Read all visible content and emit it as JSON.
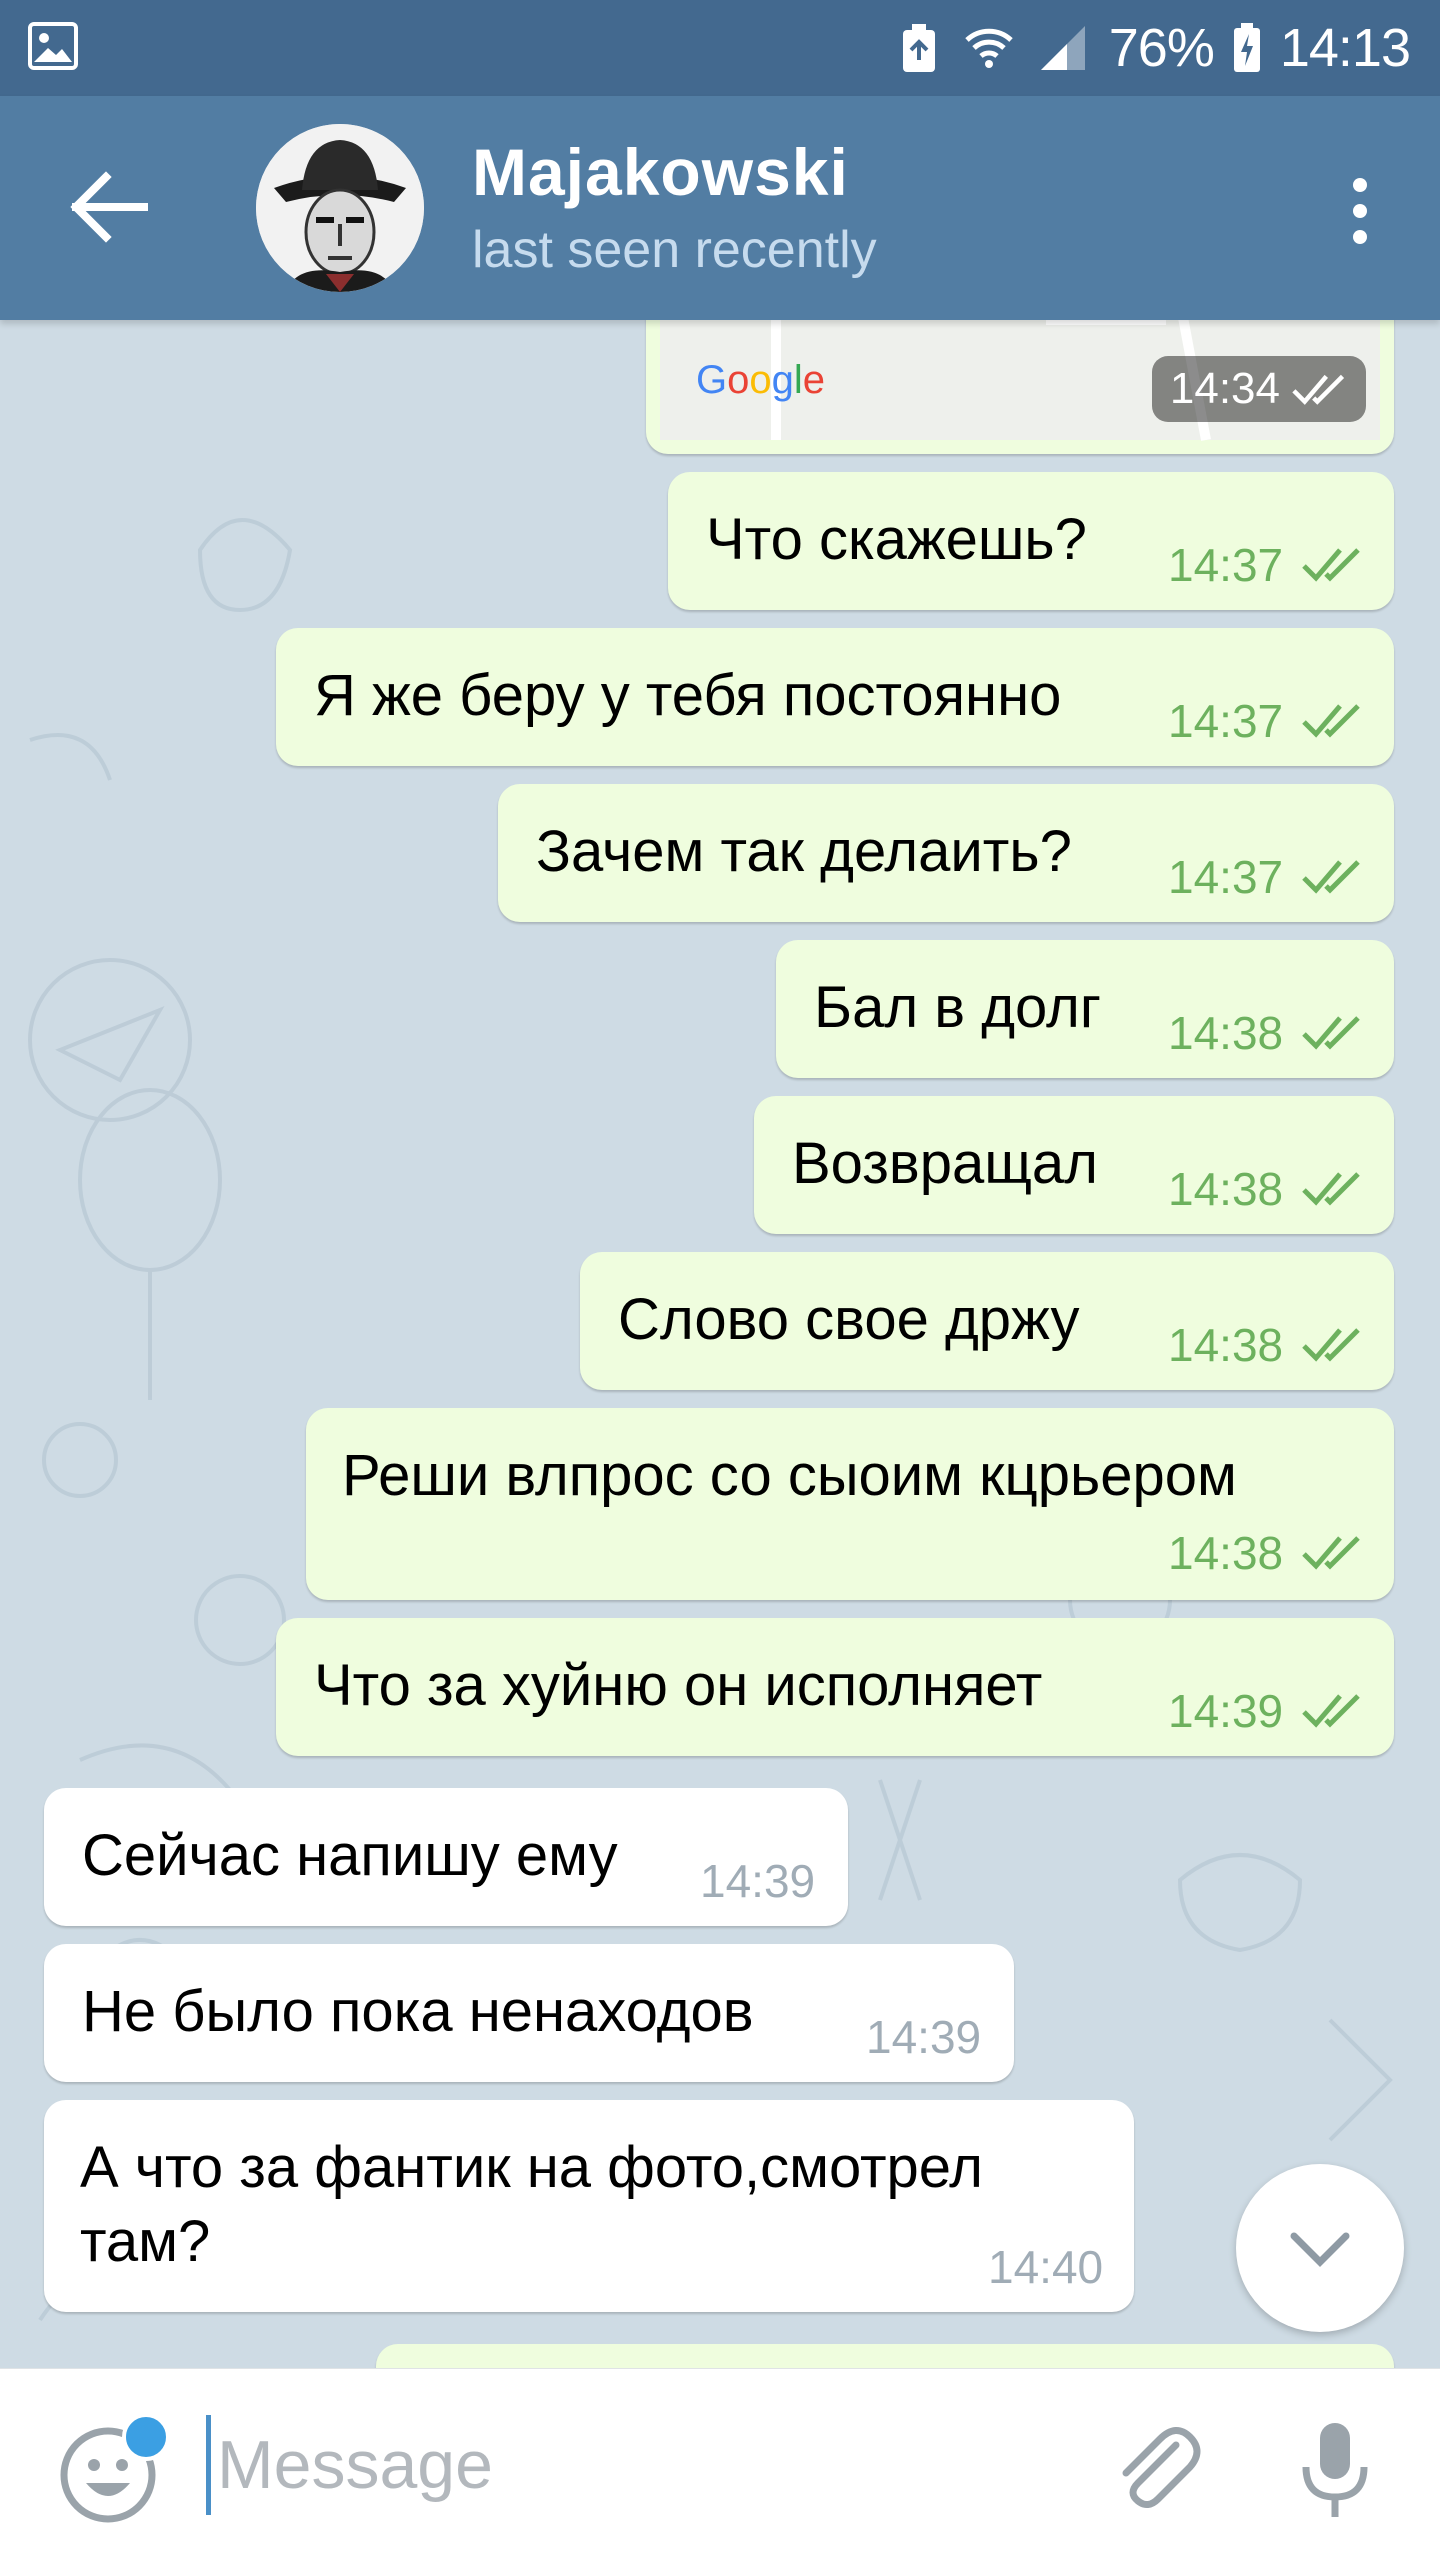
{
  "status_bar": {
    "battery": "76%",
    "time": "14:13"
  },
  "header": {
    "contact_name": "Majakowski",
    "last_seen": "last seen recently"
  },
  "chat": {
    "map_message": {
      "provider": "Google",
      "time": "14:34"
    },
    "messages": [
      {
        "dir": "out",
        "text": "Что скажешь?",
        "time": "14:37"
      },
      {
        "dir": "out",
        "text": "Я же беру у тебя постоянно",
        "time": "14:37"
      },
      {
        "dir": "out",
        "text": "Зачем так делаить?",
        "time": "14:37"
      },
      {
        "dir": "out",
        "text": "Бал в долг",
        "time": "14:38"
      },
      {
        "dir": "out",
        "text": "Возвращал",
        "time": "14:38"
      },
      {
        "dir": "out",
        "text": "Слово свое држу",
        "time": "14:38"
      },
      {
        "dir": "out",
        "text": "Реши влпрос со сыоим кцрьером",
        "time": "14:38"
      },
      {
        "dir": "out",
        "text": "Что за хуйню он исполняет",
        "time": "14:39"
      },
      {
        "dir": "in",
        "text": "Сейчас напишу ему",
        "time": "14:39"
      },
      {
        "dir": "in",
        "text": "Не было пока ненаходов",
        "time": "14:39"
      },
      {
        "dir": "in",
        "text_line1": "А что за фантик на фото,смотрел",
        "text_line2": "там?",
        "time": "14:40"
      }
    ]
  },
  "input": {
    "placeholder": "Message"
  },
  "colors": {
    "header_bg": "#527da3",
    "statusbar_bg": "#43698f",
    "outgoing_bubble": "#effdde",
    "incoming_bubble": "#ffffff",
    "check_color": "#6db15e"
  },
  "icons": [
    "gallery-icon",
    "nfc-battery-icon",
    "wifi-icon",
    "signal-icon",
    "battery-icon",
    "back-arrow-icon",
    "more-vert-icon",
    "double-check-icon",
    "chevron-down-icon",
    "emoji-icon",
    "paperclip-icon",
    "microphone-icon"
  ]
}
